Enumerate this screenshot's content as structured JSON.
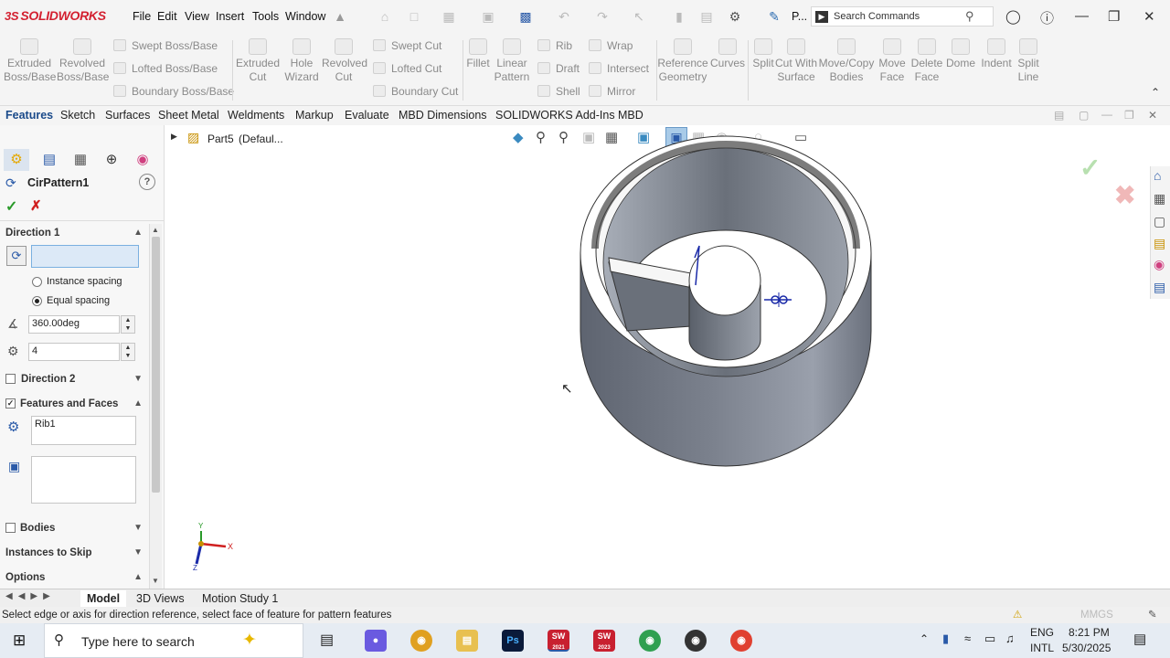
{
  "app": {
    "logo": "SOLIDWORKS",
    "logo_mark": "3S"
  },
  "menu": [
    "File",
    "Edit",
    "View",
    "Insert",
    "Tools",
    "Window"
  ],
  "title_short": "P...",
  "search": {
    "placeholder": "Search Commands"
  },
  "ribbon": {
    "extruded_boss": "Extruded Boss/Base",
    "revolved_boss": "Revolved Boss/Base",
    "swept_boss": "Swept Boss/Base",
    "lofted_boss": "Lofted Boss/Base",
    "boundary_boss": "Boundary Boss/Base",
    "extruded_cut": "Extruded Cut",
    "hole_wizard": "Hole Wizard",
    "revolved_cut": "Revolved Cut",
    "swept_cut": "Swept Cut",
    "lofted_cut": "Lofted Cut",
    "boundary_cut": "Boundary Cut",
    "fillet": "Fillet",
    "linear_pattern": "Linear Pattern",
    "rib": "Rib",
    "draft": "Draft",
    "shell": "Shell",
    "wrap": "Wrap",
    "intersect": "Intersect",
    "mirror": "Mirror",
    "reference_geometry": "Reference Geometry",
    "curves": "Curves",
    "split": "Split",
    "cut_with_surface": "Cut With Surface",
    "move_copy_bodies": "Move/Copy Bodies",
    "move_face": "Move Face",
    "delete_face": "Delete Face",
    "dome": "Dome",
    "indent": "Indent",
    "split_line": "Split Line"
  },
  "tabs": [
    "Features",
    "Sketch",
    "Surfaces",
    "Sheet Metal",
    "Weldments",
    "Markup",
    "Evaluate",
    "MBD Dimensions",
    "SOLIDWORKS Add-Ins",
    "MBD"
  ],
  "property": {
    "title": "CirPattern1",
    "direction1": "Direction 1",
    "direction1_value": "",
    "instance_spacing": "Instance spacing",
    "equal_spacing": "Equal spacing",
    "angle": "360.00deg",
    "count": "4",
    "direction2": "Direction 2",
    "features_faces": "Features and Faces",
    "feature_item": "Rib1",
    "bodies": "Bodies",
    "instances_skip": "Instances to Skip",
    "options": "Options"
  },
  "tree": {
    "part": "Part5",
    "config": "(Defaul..."
  },
  "bottom_tabs": [
    "Model",
    "3D Views",
    "Motion Study 1"
  ],
  "status": "Select edge or axis for direction reference, select face of feature for pattern features",
  "status_right": "MMGS",
  "taskbar": {
    "search": "Type here to search",
    "lang1": "ENG",
    "lang2": "INTL",
    "time": "8:21 PM",
    "date": "5/30/2025",
    "ps": "Ps",
    "sw": "SW",
    "sw_ver1": "2021",
    "sw_ver2": "2023"
  },
  "axis_labels": {
    "x": "X",
    "y": "Y",
    "z": "Z"
  }
}
